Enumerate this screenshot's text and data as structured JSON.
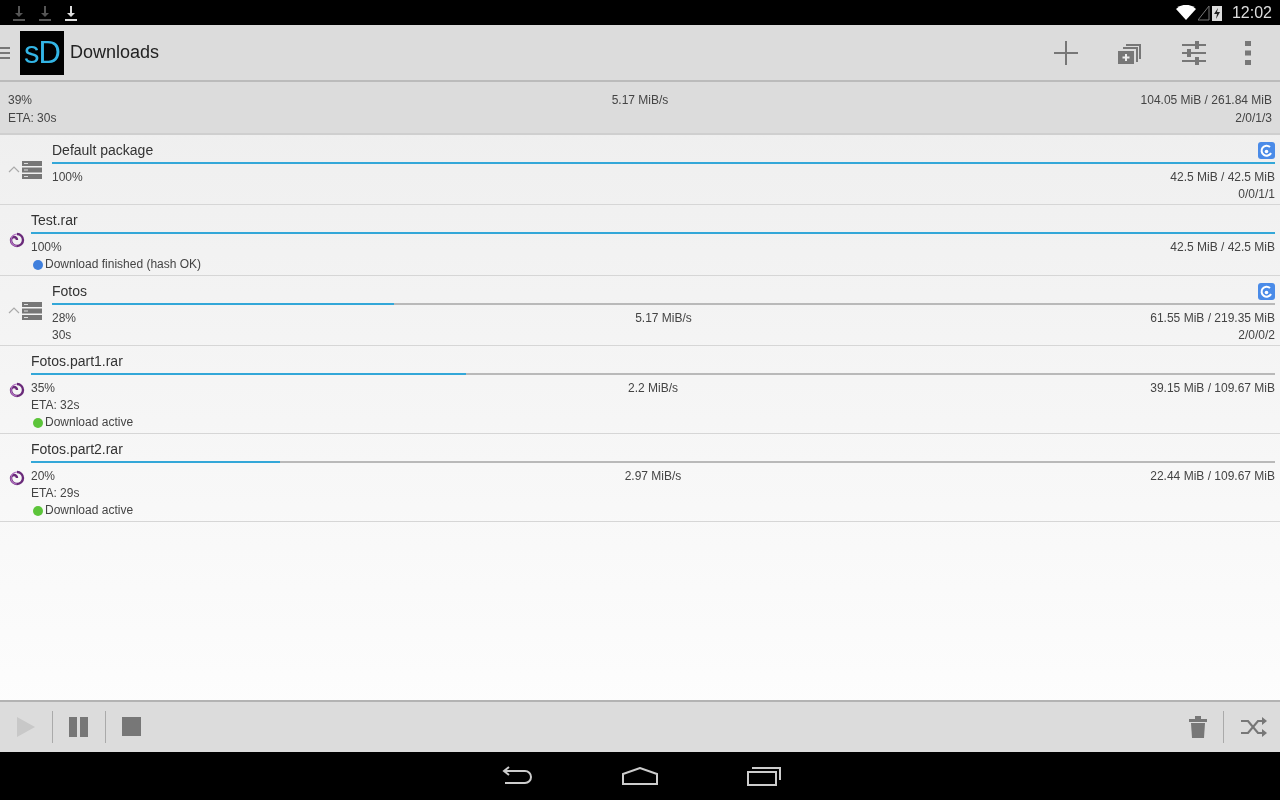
{
  "status_bar": {
    "time": "12:02"
  },
  "action_bar": {
    "logo": "sD",
    "title": "Downloads"
  },
  "summary": {
    "percent": "39%",
    "eta": "ETA: 30s",
    "speed": "5.17 MiB/s",
    "size": "104.05 MiB / 261.84 MiB",
    "counts": "2/0/1/3"
  },
  "rows": [
    {
      "kind": "package",
      "expanded": true,
      "name": "Default package",
      "level": 1.0,
      "percent": "100%",
      "size": "42.5 MiB / 42.5 MiB",
      "counts": "0/0/1/1"
    },
    {
      "kind": "file",
      "name": "Test.rar",
      "level": 1.0,
      "percent": "100%",
      "size": "42.5 MiB / 42.5 MiB",
      "status": "Download finished (hash OK)",
      "color": "#3f7fdc"
    },
    {
      "kind": "package",
      "expanded": true,
      "name": "Fotos",
      "level": 0.28,
      "percent": "28%",
      "speed": "5.17 MiB/s",
      "size": "61.55 MiB / 219.35 MiB",
      "eta": "30s",
      "counts": "2/0/0/2"
    },
    {
      "kind": "file",
      "name": "Fotos.part1.rar",
      "level": 0.35,
      "percent": "35%",
      "speed": "2.2 MiB/s",
      "size": "39.15 MiB / 109.67 MiB",
      "eta": "ETA: 32s",
      "status": "Download active",
      "color": "#5cc43a"
    },
    {
      "kind": "file",
      "name": "Fotos.part2.rar",
      "level": 0.2,
      "percent": "20%",
      "speed": "2.97 MiB/s",
      "size": "22.44 MiB / 109.67 MiB",
      "eta": "ETA: 29s",
      "status": "Download active",
      "color": "#5cc43a"
    }
  ],
  "toolbar": {
    "play_disabled": true
  }
}
